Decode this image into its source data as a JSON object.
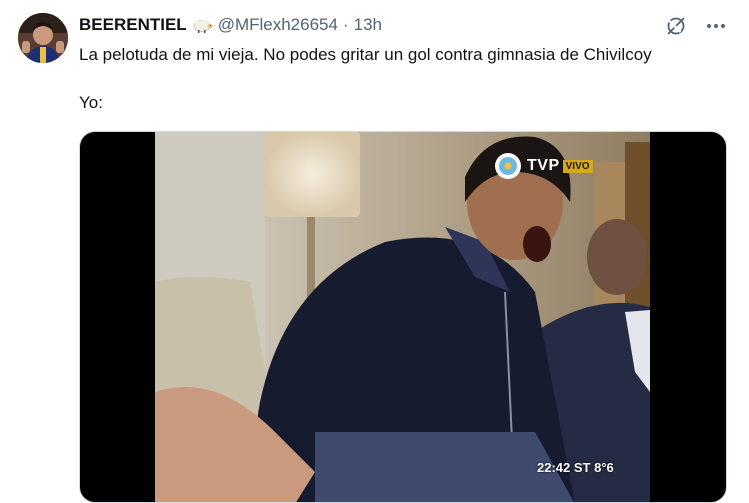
{
  "tweet": {
    "display_name": "BEERENTIEL",
    "handle": "@MFlexh26654",
    "separator": "·",
    "time": "13h",
    "text_line1": "La pelotuda de mi vieja. No podes gritar un gol contra gimnasia de Chivilcoy",
    "text_line2": "Yo:"
  },
  "media": {
    "channel": "TVP",
    "live_badge": "VIVO",
    "clock": "22:42 ST 8°6"
  },
  "icons": {
    "emoji": "sheep-icon",
    "grok": "grok-icon",
    "more": "more-icon"
  },
  "colors": {
    "text": "#0f1419",
    "secondary": "#536471",
    "live_badge": "#d4a91b"
  }
}
